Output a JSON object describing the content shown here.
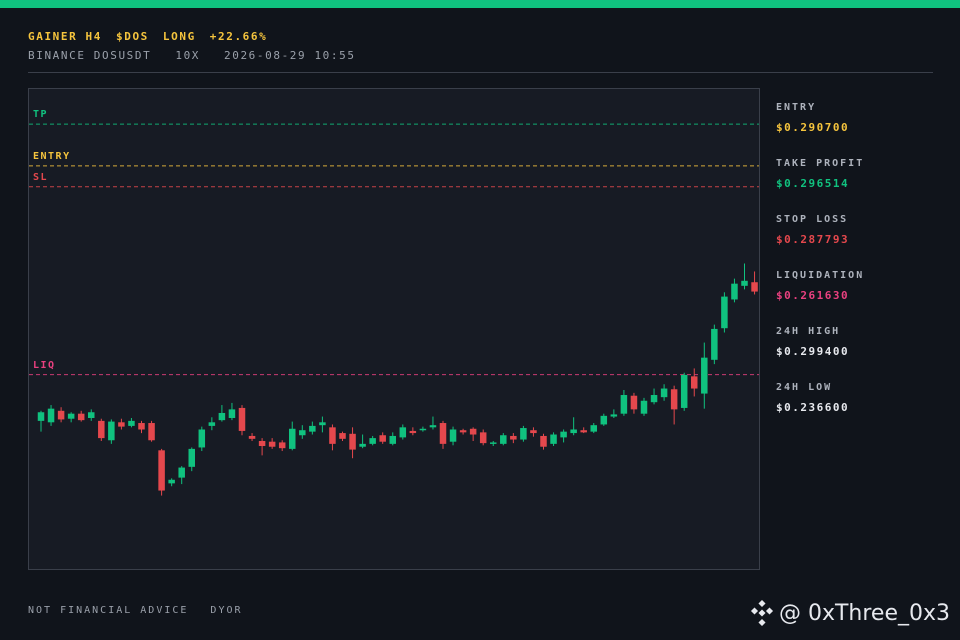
{
  "header": {
    "tag": "GAINER H4",
    "symbol": "$DOS",
    "side": "LONG",
    "change": "+22.66%",
    "exchange": "BINANCE DOSUSDT",
    "leverage": "10X",
    "timestamp": "2026-08-29 10:55"
  },
  "levels": {
    "tp_label": "TP",
    "entry_label": "ENTRY",
    "sl_label": "SL",
    "liq_label": "LIQ"
  },
  "colors": {
    "accent": "#10c27f",
    "up": "#10c27f",
    "down": "#e5484d",
    "tp": "#10c27f",
    "entry": "#f5c43d",
    "sl": "#e5484d",
    "liq": "#e9407f"
  },
  "sidebar": [
    {
      "label": "ENTRY",
      "value": "$0.290700",
      "color": "#f5c43d"
    },
    {
      "label": "TAKE PROFIT",
      "value": "$0.296514",
      "color": "#10c27f"
    },
    {
      "label": "STOP LOSS",
      "value": "$0.287793",
      "color": "#e5484d"
    },
    {
      "label": "LIQUIDATION",
      "value": "$0.261630",
      "color": "#e9407f"
    },
    {
      "label": "24H HIGH",
      "value": "$0.299400",
      "color": "#e7e9ee"
    },
    {
      "label": "24H LOW",
      "value": "$0.236600",
      "color": "#e7e9ee"
    }
  ],
  "footer": {
    "disclaimer": "NOT FINANCIAL ADVICE",
    "dyor": "DYOR"
  },
  "watermark": {
    "handle": "@ 0xThree_0x3",
    "icon": "binance-logo-icon"
  },
  "chart_data": {
    "type": "candlestick",
    "price_range": [
      0.2343,
      0.3014
    ],
    "levels": {
      "tp": 0.296514,
      "entry": 0.2907,
      "sl": 0.287793,
      "liq": 0.26163
    },
    "candles": [
      [
        0.2552,
        0.2564,
        0.2537,
        0.2566
      ],
      [
        0.255,
        0.2569,
        0.2545,
        0.2574
      ],
      [
        0.2566,
        0.2554,
        0.255,
        0.2571
      ],
      [
        0.2555,
        0.2562,
        0.255,
        0.2564
      ],
      [
        0.2562,
        0.2553,
        0.2551,
        0.2566
      ],
      [
        0.2556,
        0.2564,
        0.2552,
        0.2568
      ],
      [
        0.2552,
        0.2528,
        0.2524,
        0.2555
      ],
      [
        0.2525,
        0.2551,
        0.252,
        0.2554
      ],
      [
        0.255,
        0.2544,
        0.254,
        0.2555
      ],
      [
        0.2545,
        0.2552,
        0.2543,
        0.2556
      ],
      [
        0.2549,
        0.254,
        0.2535,
        0.2552
      ],
      [
        0.2549,
        0.2525,
        0.2523,
        0.2552
      ],
      [
        0.2511,
        0.2455,
        0.2448,
        0.2513
      ],
      [
        0.2465,
        0.247,
        0.2461,
        0.2472
      ],
      [
        0.2473,
        0.2487,
        0.2464,
        0.2489
      ],
      [
        0.2488,
        0.2513,
        0.2482,
        0.2515
      ],
      [
        0.2515,
        0.254,
        0.251,
        0.2544
      ],
      [
        0.2545,
        0.255,
        0.2539,
        0.2557
      ],
      [
        0.2553,
        0.2563,
        0.2551,
        0.2574
      ],
      [
        0.2556,
        0.2568,
        0.2553,
        0.2577
      ],
      [
        0.257,
        0.2538,
        0.2532,
        0.2574
      ],
      [
        0.2531,
        0.2527,
        0.2524,
        0.2535
      ],
      [
        0.2524,
        0.2517,
        0.2504,
        0.2528
      ],
      [
        0.2523,
        0.2516,
        0.2513,
        0.2528
      ],
      [
        0.2522,
        0.2514,
        0.251,
        0.2525
      ],
      [
        0.2513,
        0.2541,
        0.2511,
        0.2551
      ],
      [
        0.2532,
        0.2539,
        0.2527,
        0.2546
      ],
      [
        0.2537,
        0.2545,
        0.2533,
        0.2551
      ],
      [
        0.2546,
        0.255,
        0.2536,
        0.2558
      ],
      [
        0.2543,
        0.252,
        0.2511,
        0.2547
      ],
      [
        0.2535,
        0.2527,
        0.2524,
        0.2537
      ],
      [
        0.2534,
        0.2512,
        0.25,
        0.2543
      ],
      [
        0.2516,
        0.252,
        0.2514,
        0.2533
      ],
      [
        0.252,
        0.2528,
        0.2518,
        0.2531
      ],
      [
        0.2532,
        0.2523,
        0.252,
        0.2536
      ],
      [
        0.252,
        0.2531,
        0.2518,
        0.2536
      ],
      [
        0.2529,
        0.2543,
        0.2526,
        0.2547
      ],
      [
        0.2538,
        0.2535,
        0.2532,
        0.2543
      ],
      [
        0.254,
        0.2541,
        0.2537,
        0.2544
      ],
      [
        0.2543,
        0.2546,
        0.254,
        0.2558
      ],
      [
        0.2549,
        0.252,
        0.2513,
        0.2552
      ],
      [
        0.2523,
        0.254,
        0.2518,
        0.2544
      ],
      [
        0.2539,
        0.2536,
        0.2533,
        0.2541
      ],
      [
        0.2541,
        0.2533,
        0.2524,
        0.2543
      ],
      [
        0.2536,
        0.2521,
        0.2518,
        0.254
      ],
      [
        0.252,
        0.2522,
        0.2517,
        0.2524
      ],
      [
        0.252,
        0.2532,
        0.2518,
        0.2535
      ],
      [
        0.2531,
        0.2526,
        0.2521,
        0.2535
      ],
      [
        0.2526,
        0.2542,
        0.2523,
        0.2545
      ],
      [
        0.2539,
        0.2535,
        0.253,
        0.2543
      ],
      [
        0.2531,
        0.2516,
        0.2512,
        0.2534
      ],
      [
        0.252,
        0.2533,
        0.2517,
        0.2536
      ],
      [
        0.2529,
        0.2537,
        0.2522,
        0.254
      ],
      [
        0.2535,
        0.254,
        0.2532,
        0.2557
      ],
      [
        0.2539,
        0.2536,
        0.2535,
        0.2543
      ],
      [
        0.2537,
        0.2546,
        0.2535,
        0.2549
      ],
      [
        0.2547,
        0.2559,
        0.2545,
        0.2562
      ],
      [
        0.2558,
        0.2561,
        0.2556,
        0.2568
      ],
      [
        0.2562,
        0.2588,
        0.2559,
        0.2595
      ],
      [
        0.2587,
        0.2568,
        0.2562,
        0.2591
      ],
      [
        0.2562,
        0.258,
        0.2559,
        0.2584
      ],
      [
        0.2578,
        0.2588,
        0.2575,
        0.2597
      ],
      [
        0.2585,
        0.2597,
        0.258,
        0.2603
      ],
      [
        0.2596,
        0.2568,
        0.2547,
        0.2601
      ],
      [
        0.257,
        0.2616,
        0.2566,
        0.2619
      ],
      [
        0.2614,
        0.2597,
        0.2586,
        0.2625
      ],
      [
        0.259,
        0.264,
        0.2569,
        0.2661
      ],
      [
        0.2637,
        0.268,
        0.2631,
        0.2686
      ],
      [
        0.2681,
        0.2725,
        0.2675,
        0.2731
      ],
      [
        0.2721,
        0.2743,
        0.2717,
        0.275
      ],
      [
        0.274,
        0.2747,
        0.2735,
        0.2771
      ],
      [
        0.2745,
        0.2732,
        0.2728,
        0.276
      ],
      [
        0.2724,
        0.2846,
        0.271,
        0.2874
      ],
      [
        0.2848,
        0.2939,
        0.2822,
        0.2955
      ],
      [
        0.2934,
        0.2927,
        0.2903,
        0.2951
      ],
      [
        0.2928,
        0.2878,
        0.287,
        0.2931
      ]
    ]
  }
}
